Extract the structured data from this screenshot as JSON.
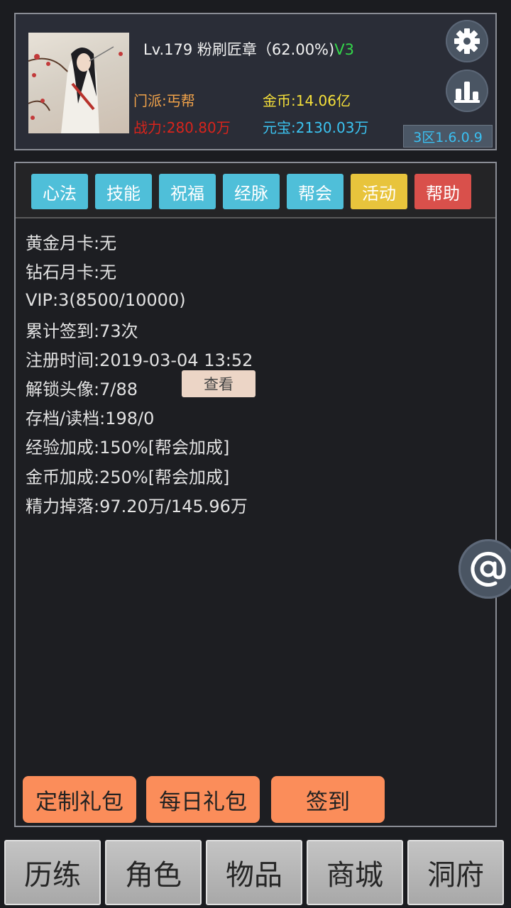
{
  "player": {
    "level_text": "Lv.179 粉刷匠章（62.00%)",
    "vip_tag": "V3",
    "sect": "门派:丐帮",
    "gold": "金币:14.06亿",
    "power": "战力:280.80万",
    "yuanbao": "元宝:2130.03万",
    "server": "3区1.6.0.9"
  },
  "header_buttons": {
    "settings_icon": "gear-icon",
    "stats_icon": "bar-chart-icon"
  },
  "tabs": [
    {
      "label": "心法",
      "color": "#4fbfd9"
    },
    {
      "label": "技能",
      "color": "#4fbfd9"
    },
    {
      "label": "祝福",
      "color": "#4fbfd9"
    },
    {
      "label": "经脉",
      "color": "#4fbfd9"
    },
    {
      "label": "帮会",
      "color": "#4fbfd9"
    },
    {
      "label": "活动",
      "color": "#e8c43c"
    },
    {
      "label": "帮助",
      "color": "#d9504b"
    }
  ],
  "info_lines": [
    "黄金月卡:无",
    "钻石月卡:无",
    "VIP:3(8500/10000)",
    "累计签到:73次",
    "注册时间:2019-03-04 13:52",
    "解锁头像:7/88",
    "存档/读档:198/0",
    "经验加成:150%[帮会加成]",
    "金币加成:250%[帮会加成]",
    "精力掉落:97.20万/145.96万"
  ],
  "view_button": "查看",
  "gift_buttons": [
    "定制礼包",
    "每日礼包",
    "签到"
  ],
  "floating": {
    "at_icon": "at-sign-icon"
  },
  "bottom_nav": [
    "历练",
    "角色",
    "物品",
    "商城",
    "洞府"
  ]
}
